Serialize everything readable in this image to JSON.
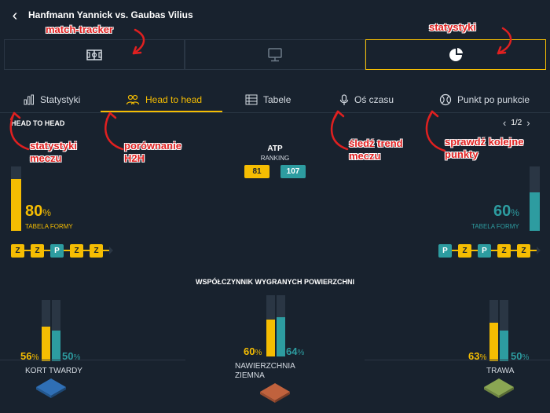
{
  "header": {
    "title": "Hanfmann Yannick vs. Gaubas Vilius"
  },
  "annotations": {
    "match_tracker": "match-tracker",
    "statystyki_top": "statystyki",
    "stats_line1": "statystyki",
    "stats_line2": "meczu",
    "h2h_line1": "porównanie",
    "h2h_line2": "H2H",
    "trend_line1": "śledź trend",
    "trend_line2": "meczu",
    "points_line1": "sprawdź kolejne",
    "points_line2": "punkty"
  },
  "tabs": [
    {
      "label": "Statystyki",
      "icon": "bar-chart-icon"
    },
    {
      "label": "Head to head",
      "icon": "users-icon"
    },
    {
      "label": "Tabele",
      "icon": "table-icon"
    },
    {
      "label": "Oś czasu",
      "icon": "microphone-icon"
    },
    {
      "label": "Punkt po punkcie",
      "icon": "tennis-ball-icon"
    }
  ],
  "section_label": "HEAD TO HEAD",
  "pager": {
    "text": "1/2"
  },
  "atp": {
    "label": "ATP",
    "ranking_label": "RANKING",
    "player1": "81",
    "player2": "107"
  },
  "form": {
    "label": "TABELA FORMY",
    "player1": {
      "value": 80,
      "results": [
        "Z",
        "Z",
        "P",
        "Z",
        "Z"
      ]
    },
    "player2": {
      "value": 60,
      "results": [
        "P",
        "Z",
        "P",
        "Z",
        "Z"
      ]
    }
  },
  "surfaces": {
    "title": "WSPÓŁCZYNNIK WYGRANYCH POWIERZCHNI",
    "items": [
      {
        "name": "KORT TWARDY",
        "p1": 56,
        "p2": 50
      },
      {
        "name": "NAWIERZCHNIA ZIEMNA",
        "p1": 60,
        "p2": 64
      },
      {
        "name": "TRAWA",
        "p1": 63,
        "p2": 50
      }
    ]
  },
  "colors": {
    "accent": "#f5bd02",
    "teal": "#2d9ca0",
    "background": "#18222e",
    "annotation": "#e02020",
    "hard_court": "#2f6fb5",
    "clay": "#c0623d",
    "grass": "#8aa653"
  }
}
